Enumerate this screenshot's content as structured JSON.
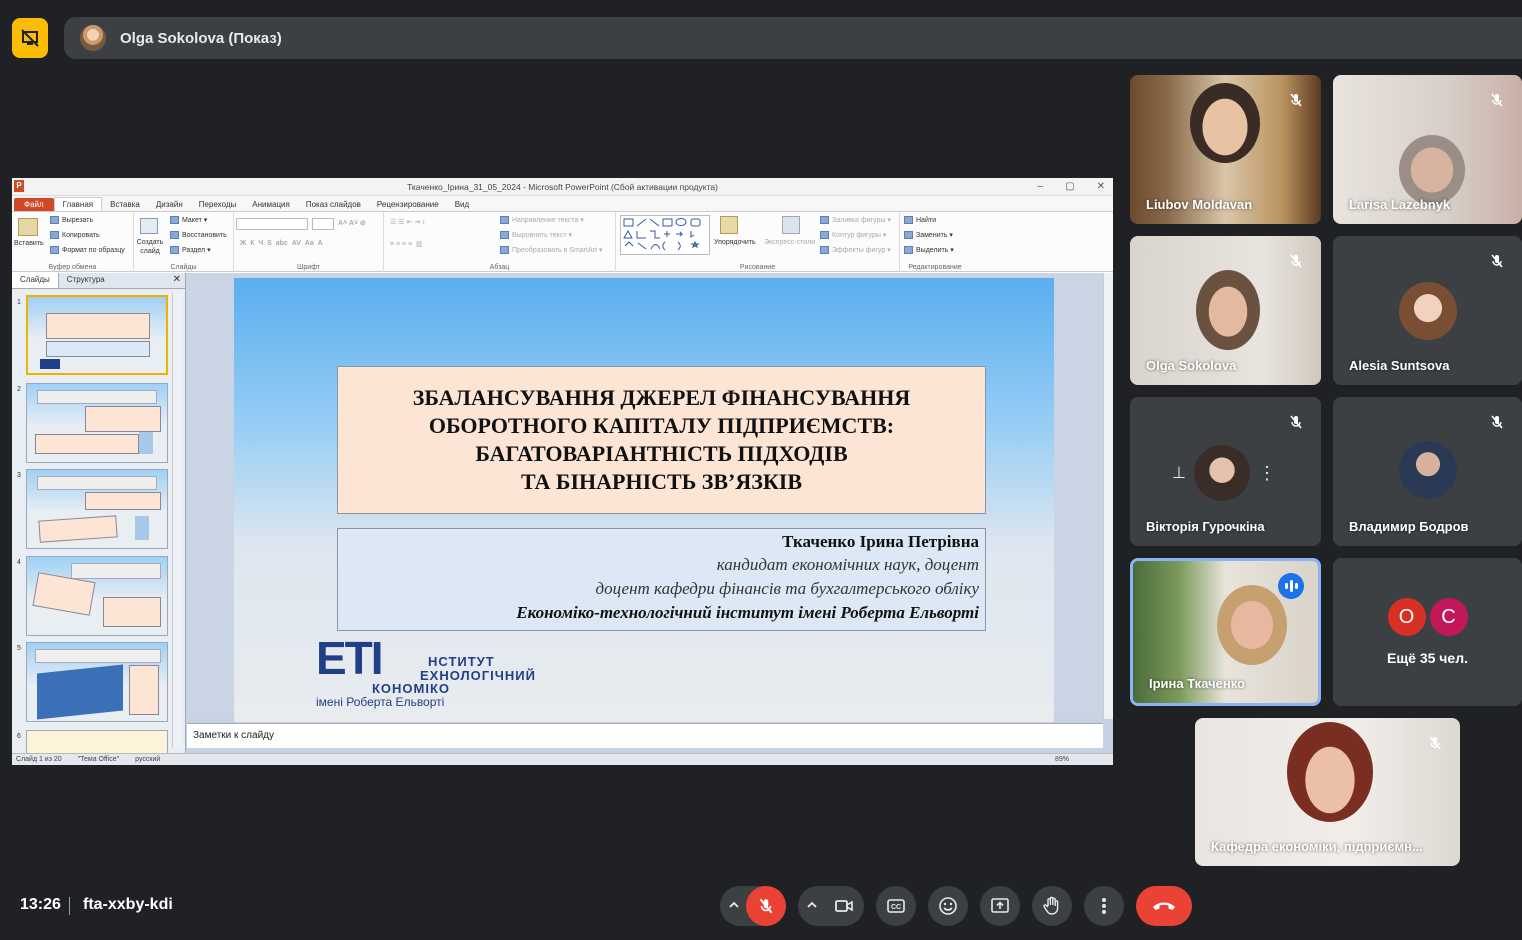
{
  "meeting": {
    "presenter_label": "Olga Sokolova (Показ)",
    "time": "13:26",
    "code": "fta-xxby-kdi"
  },
  "ppt": {
    "window_title": "Ткаченко_Ірина_31_05_2024 - Microsoft PowerPoint (Сбой активации продукта)",
    "tabs": [
      "Файл",
      "Главная",
      "Вставка",
      "Дизайн",
      "Переходы",
      "Анимация",
      "Показ слайдов",
      "Рецензирование",
      "Вид"
    ],
    "ribbon": {
      "paste": "Вставить",
      "cut": "Вырезать",
      "copy": "Копировать",
      "format_painter": "Формат по образцу",
      "clipboard_group": "Буфер обмена",
      "new_slide": "Создать слайд",
      "layout": "Макет",
      "reset": "Восстановить",
      "section": "Раздел",
      "slides_group": "Слайды",
      "font_group": "Шрифт",
      "text_direction": "Направление текста",
      "align_text": "Выровнять текст",
      "smartart": "Преобразовать в SmartArt",
      "paragraph_group": "Абзац",
      "arrange": "Упорядочить",
      "quick_styles": "Экспресс-стили",
      "shape_fill": "Заливка фигуры",
      "shape_outline": "Контур фигуры",
      "shape_effects": "Эффекты фигур",
      "drawing_group": "Рисование",
      "find": "Найти",
      "replace": "Заменить",
      "select": "Выделить",
      "editing_group": "Редактирование"
    },
    "panel_tabs": [
      "Слайды",
      "Структура"
    ],
    "slide_numbers": [
      "1",
      "2",
      "3",
      "4",
      "5",
      "6"
    ],
    "slide": {
      "title": "ЗБАЛАНСУВАННЯ ДЖЕРЕЛ ФІНАНСУВАННЯ\nОБОРОТНОГО КАПІТАЛУ ПІДПРИЄМСТВ:\nБАГАТОВАРІАНТНІСТЬ ПІДХОДІВ\nТА БІНАРНІСТЬ ЗВ’ЯЗКІВ",
      "author": "Ткаченко Ірина Петрівна",
      "degree": "кандидат економічних наук, доцент",
      "position": "доцент кафедри фінансів та бухгалтерського обліку",
      "institution": "Економіко-технологічний інститут імені Роберта Ельворті",
      "logo_letters": "ETI",
      "logo_line1": "НСТИТУТ",
      "logo_line2": "ЕХНОЛОГІЧНИЙ",
      "logo_line3": "КОНОМІКО",
      "logo_line4": "імені Роберта Ельворті"
    },
    "notes_placeholder": "Заметки к слайду",
    "status": {
      "slide_count": "Слайд 1 из 20",
      "theme": "\"Тема Office\"",
      "language": "русский",
      "zoom": "89%"
    }
  },
  "participants": [
    {
      "name": "Liubov Moldavan",
      "muted": true
    },
    {
      "name": "Larisa Lazebnyk",
      "muted": true
    },
    {
      "name": "Olga Sokolova",
      "muted": true
    },
    {
      "name": "Alesia Suntsova",
      "muted": true
    },
    {
      "name": "Вікторія Гурочкіна",
      "muted": true
    },
    {
      "name": "Владимир Бодров",
      "muted": true
    },
    {
      "name": "Ірина Ткаченко",
      "speaking": true
    },
    {
      "name": "Кафедра економіки, підприємн...",
      "muted": true
    }
  ],
  "more_participants": {
    "label": "Ещё 35 чел.",
    "initials": [
      "O",
      "C"
    ],
    "colors": [
      "#d93025",
      "#c2185b"
    ]
  },
  "colors": {
    "background": "#202124",
    "tile": "#3c4043",
    "end_call": "#ea4335",
    "speaking": "#1a73e8",
    "present_badge": "#fbbc04"
  }
}
